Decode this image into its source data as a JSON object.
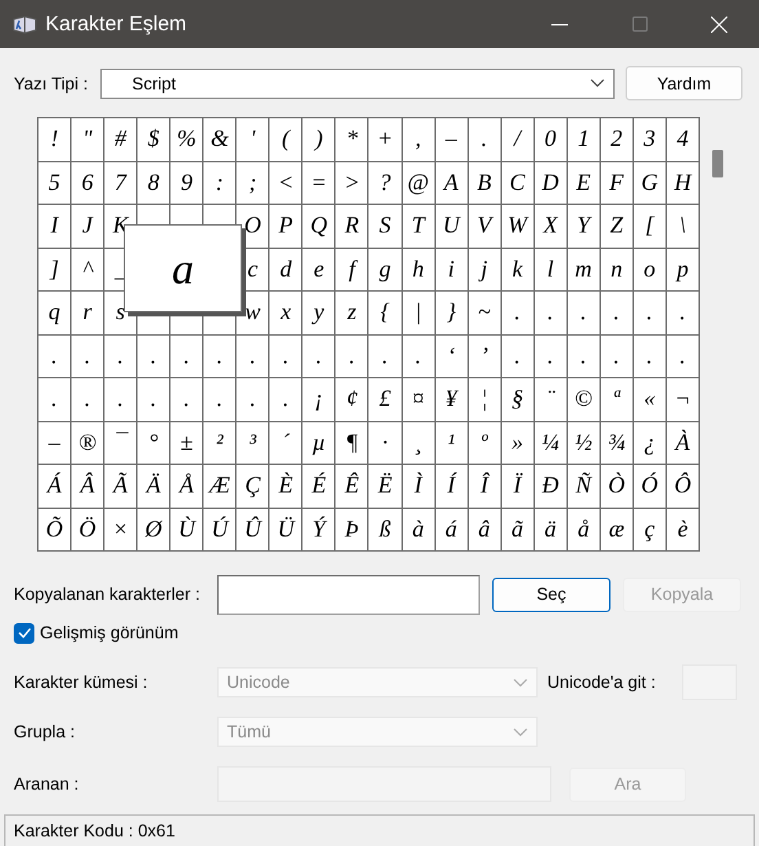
{
  "window": {
    "title": "Karakter Eşlem"
  },
  "font_row": {
    "label": "Yazı Tipi :",
    "value": "Script",
    "help_button": "Yardım"
  },
  "grid": {
    "rows": [
      [
        "!",
        "\"",
        "#",
        "$",
        "%",
        "&",
        "'",
        "(",
        ")",
        "*",
        "+",
        ",",
        "–",
        ".",
        "/",
        "0",
        "1",
        "2",
        "3",
        "4"
      ],
      [
        "5",
        "6",
        "7",
        "8",
        "9",
        ":",
        ";",
        "<",
        "=",
        ">",
        "?",
        "@",
        "A",
        "B",
        "C",
        "D",
        "E",
        "F",
        "G",
        "H"
      ],
      [
        "I",
        "J",
        "K",
        null,
        null,
        null,
        "O",
        "P",
        "Q",
        "R",
        "S",
        "T",
        "U",
        "V",
        "W",
        "X",
        "Y",
        "Z",
        "[",
        "\\"
      ],
      [
        "]",
        "^",
        "_",
        null,
        null,
        null,
        "c",
        "d",
        "e",
        "f",
        "g",
        "h",
        "i",
        "j",
        "k",
        "l",
        "m",
        "n",
        "o",
        "p"
      ],
      [
        "q",
        "r",
        "s",
        null,
        null,
        null,
        "w",
        "x",
        "y",
        "z",
        "{",
        "|",
        "}",
        "~",
        ".",
        ".",
        ".",
        ".",
        ".",
        "."
      ],
      [
        ".",
        ".",
        ".",
        ".",
        ".",
        ".",
        ".",
        ".",
        ".",
        ".",
        ".",
        ".",
        "‘",
        "’",
        ".",
        ".",
        ".",
        ".",
        ".",
        "."
      ],
      [
        ".",
        ".",
        ".",
        ".",
        ".",
        ".",
        ".",
        ".",
        "¡",
        "¢",
        "£",
        "¤",
        "¥",
        "¦",
        "§",
        "¨",
        "©",
        "ª",
        "«",
        "¬"
      ],
      [
        "–",
        "®",
        "¯",
        "°",
        "±",
        "²",
        "³",
        "´",
        "µ",
        "¶",
        "·",
        "¸",
        "¹",
        "º",
        "»",
        "¼",
        "½",
        "¾",
        "¿",
        "À"
      ],
      [
        "Á",
        "Â",
        "Ã",
        "Ä",
        "Å",
        "Æ",
        "Ç",
        "È",
        "É",
        "Ê",
        "Ë",
        "Ì",
        "Í",
        "Î",
        "Ï",
        "Ð",
        "Ñ",
        "Ò",
        "Ó",
        "Ô"
      ],
      [
        "Õ",
        "Ö",
        "×",
        "Ø",
        "Ù",
        "Ú",
        "Û",
        "Ü",
        "Ý",
        "Þ",
        "ß",
        "à",
        "á",
        "â",
        "ã",
        "ä",
        "å",
        "æ",
        "ç",
        "è"
      ]
    ],
    "magnified": "a"
  },
  "copy_row": {
    "label": "Kopyalanan karakterler :",
    "select_button": "Seç",
    "copy_button": {
      "label": "Kopyala",
      "disabled": true
    }
  },
  "advanced_view": {
    "label": "Gelişmiş görünüm",
    "checked": true
  },
  "charset": {
    "label": "Karakter kümesi :",
    "value": "Unicode",
    "goto_label": "Unicode'a git :"
  },
  "group": {
    "label": "Grupla :",
    "value": "Tümü"
  },
  "search": {
    "label": "Aranan :",
    "button": {
      "label": "Ara",
      "disabled": true
    }
  },
  "status_bar": "Karakter Kodu : 0x61"
}
